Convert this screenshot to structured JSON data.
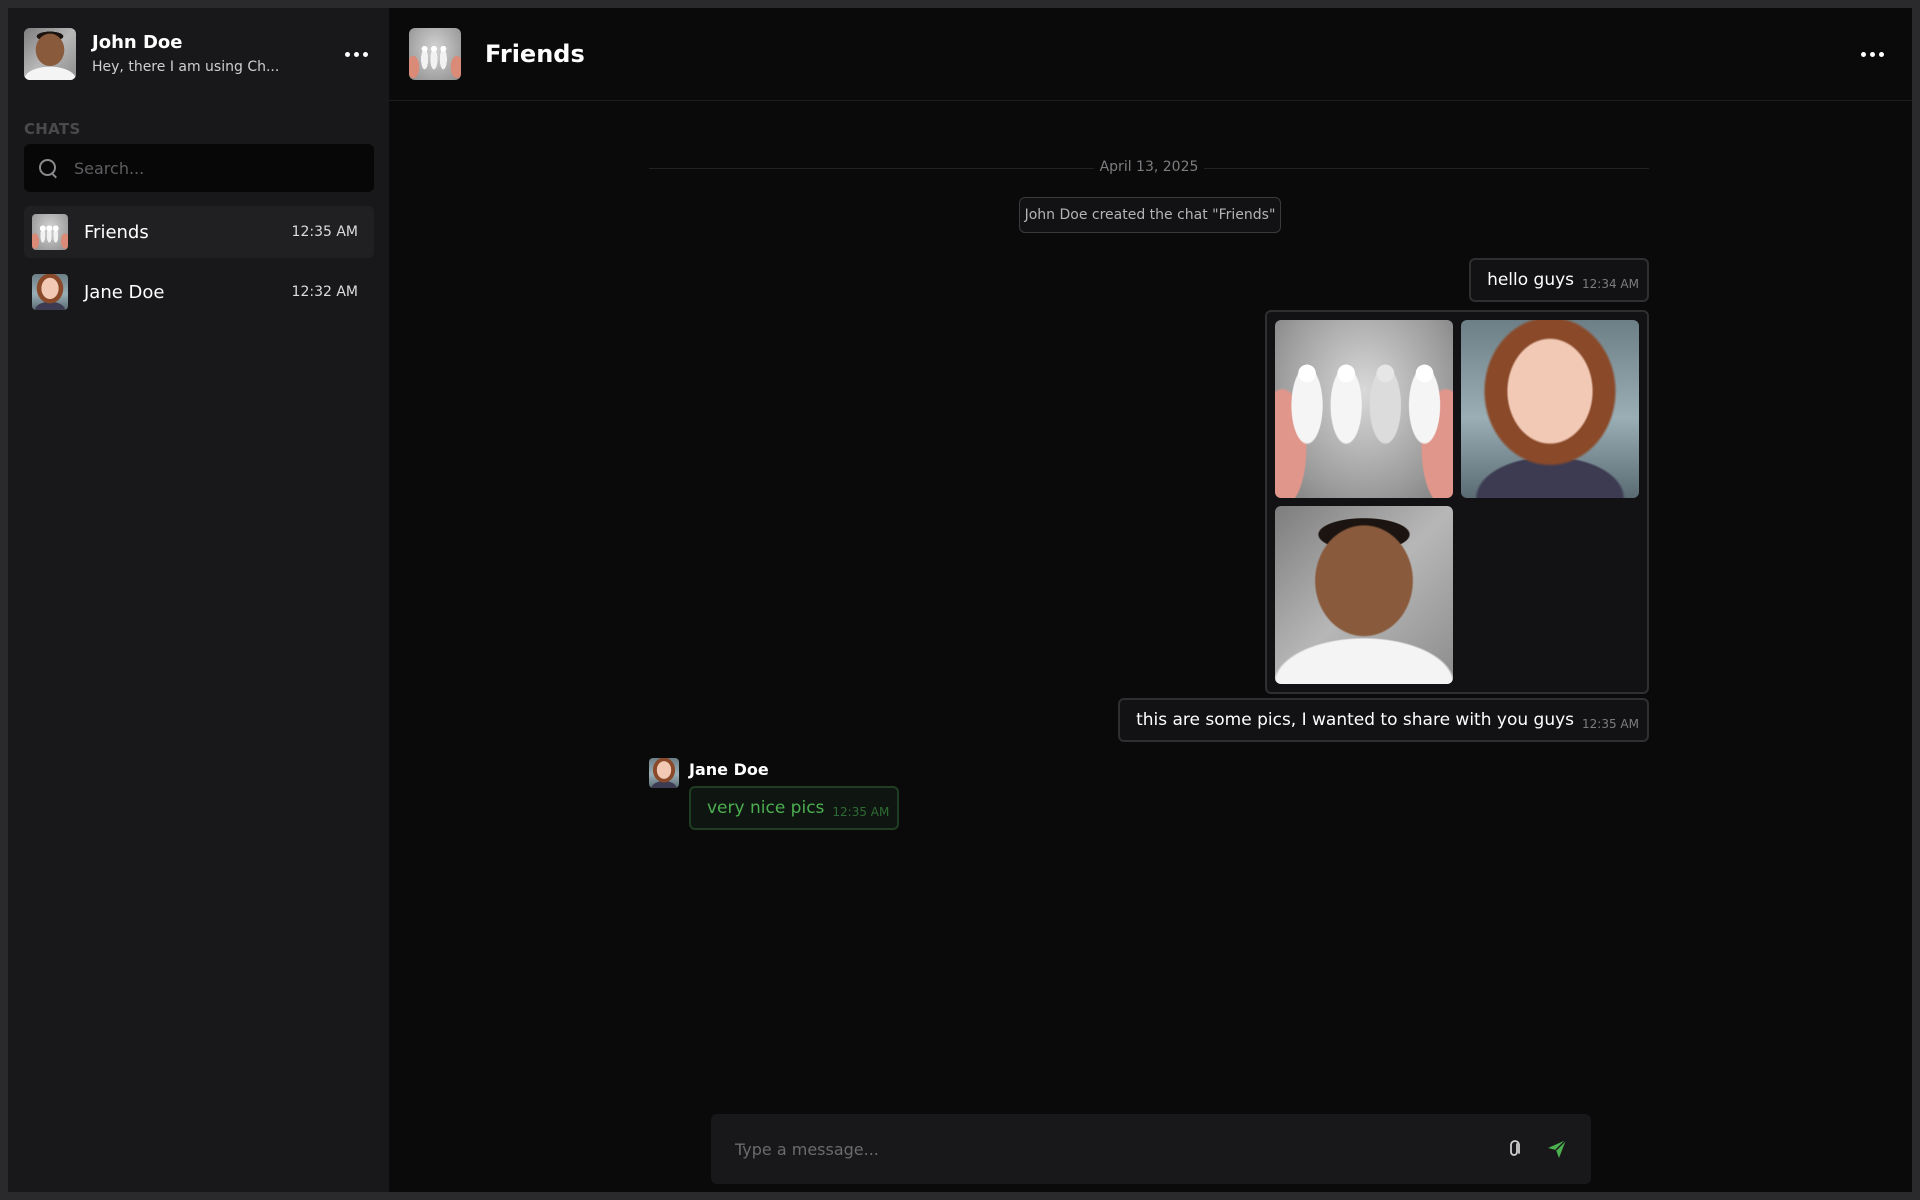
{
  "colors": {
    "accent": "#4caf50",
    "sidebar_bg": "#18181a",
    "main_bg": "#0a0a0b"
  },
  "sidebar": {
    "user": {
      "name": "John Doe",
      "status": "Hey, there I am using Ch..."
    },
    "menu_icon": "more-horizontal-icon",
    "section_label": "CHATS",
    "search": {
      "placeholder": "Search...",
      "value": ""
    },
    "chats": [
      {
        "name": "Friends",
        "time": "12:35 AM",
        "active": true
      },
      {
        "name": "Jane Doe",
        "time": "12:32 AM",
        "active": false
      }
    ]
  },
  "header": {
    "title": "Friends",
    "menu_icon": "more-horizontal-icon"
  },
  "conversation": {
    "date": "April 13, 2025",
    "system_message": "John Doe created the chat \"Friends\"",
    "messages": [
      {
        "text": "hello guys",
        "time": "12:34 AM"
      },
      {
        "text": "this are some pics, I wanted to share with you guys",
        "time": "12:35 AM"
      },
      {
        "sender": "Jane Doe",
        "text": "very nice pics",
        "time": "12:35 AM"
      }
    ],
    "gallery_count": 3
  },
  "composer": {
    "placeholder": "Type a message...",
    "attach_icon": "paperclip-icon",
    "send_icon": "send-icon"
  }
}
